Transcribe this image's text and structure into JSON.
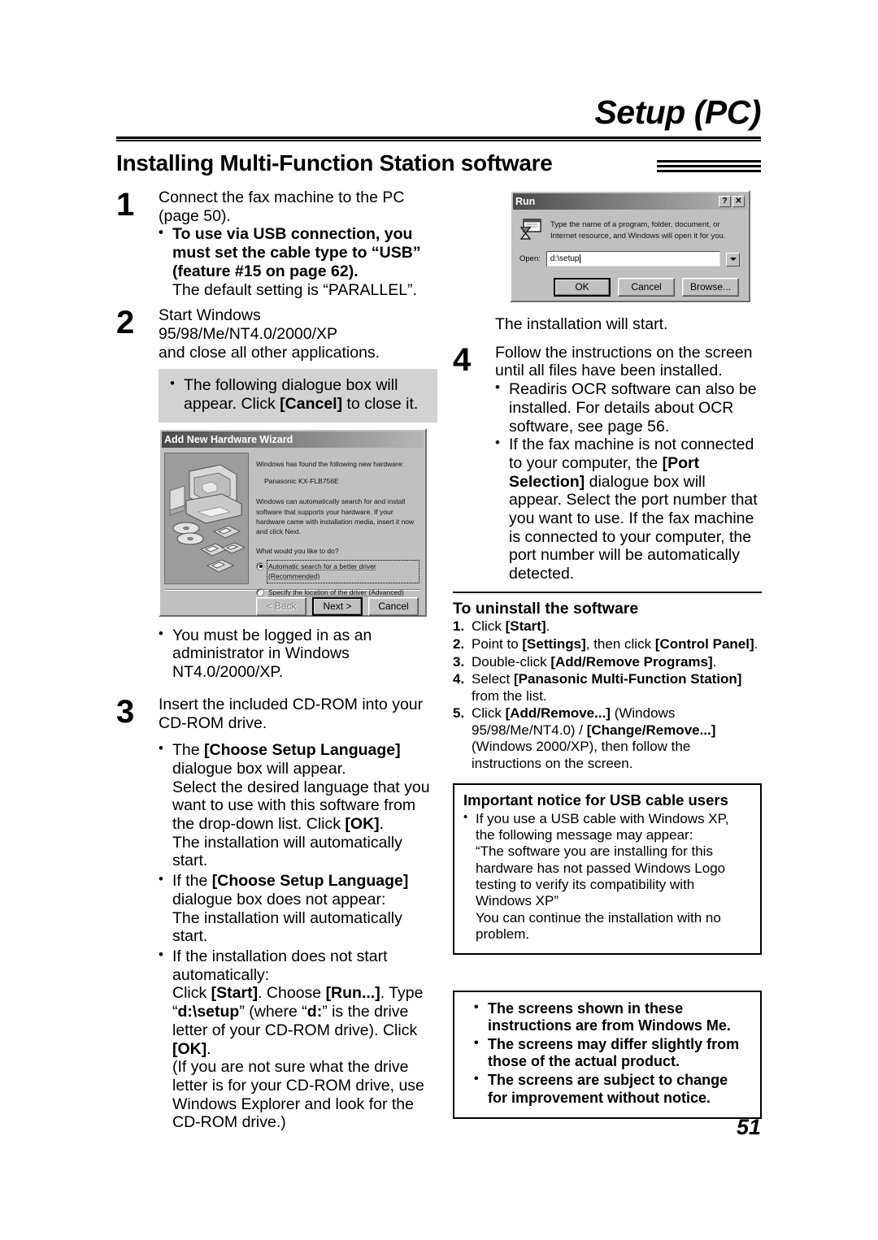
{
  "header": {
    "chapter": "Setup (PC)",
    "section": "Installing Multi-Function Station software"
  },
  "page_number": "51",
  "left_column": {
    "step1": {
      "number": "1",
      "line1": "Connect the fax machine to the PC",
      "line2": "(page 50).",
      "bullet_bold": "To use via USB connection, you must set the cable type to “USB” (feature #15 on page 62).",
      "bullet_note": "The default setting is “PARALLEL”."
    },
    "step2": {
      "number": "2",
      "line1": "Start Windows 95/98/Me/NT4.0/2000/XP",
      "line2": "and close all other applications."
    },
    "gray_callout": {
      "text_part1": "The following dialogue box will appear. Click ",
      "text_bold": "[Cancel]",
      "text_part2": " to close it."
    },
    "after_wizard_bullet": "You must be logged in as an administrator in Windows NT4.0/2000/XP.",
    "step3": {
      "number": "3",
      "line1": "Insert the included CD-ROM into your",
      "line2": "CD-ROM drive.",
      "bullet1_lead": "The ",
      "bullet1_bold": "[Choose Setup Language]",
      "bullet1_tail": " dialogue box will appear.",
      "bullet1_body_a": "Select the desired language that you want to use with this software from the drop-down list. Click ",
      "bullet1_body_ok": "[OK]",
      "bullet1_body_b": ".",
      "bullet1_body_c": "The installation will automatically start.",
      "bullet2_lead": "If the ",
      "bullet2_bold": "[Choose Setup Language]",
      "bullet2_tail": " dialogue box does not appear:",
      "bullet2_body": "The installation will automatically start.",
      "bullet3_lead": "If the installation does not start automatically:",
      "bullet3_l1_a": "Click ",
      "bullet3_l1_start": "[Start]",
      "bullet3_l1_b": ". Choose ",
      "bullet3_l1_run": "[Run...]",
      "bullet3_l1_c": ". Type",
      "bullet3_l2_a": "“",
      "bullet3_l2_path": "d:\\setup",
      "bullet3_l2_b": "” (where “",
      "bullet3_l2_drive": "d:",
      "bullet3_l2_c": "” is the drive letter of your CD-ROM drive). Click ",
      "bullet3_l2_ok": "[OK]",
      "bullet3_l2_d": ".",
      "bullet3_l3": "(If you are not sure what the drive letter is for your CD-ROM drive, use Windows Explorer and look for the CD-ROM drive.)"
    }
  },
  "wizard_dialog": {
    "title": "Add New Hardware Wizard",
    "found_text": "Windows has found the following new hardware:",
    "device_name": "Panasonic KX-FLB756E",
    "body_text": "Windows can automatically search for and install software that supports your hardware. If your hardware came with installation media, insert it now and click Next.",
    "question": "What would you like to do?",
    "option1": "Automatic search for a better driver (Recommended)",
    "option2": "Specify the location of the driver (Advanced)",
    "selected_option": "option1",
    "buttons": {
      "back": "< Back",
      "next": "Next >",
      "cancel": "Cancel"
    }
  },
  "run_dialog": {
    "title": "Run",
    "help_button": "?",
    "close_button": "✕",
    "description": "Type the name of a program, folder, document, or Internet resource, and Windows will open it for you.",
    "open_label": "Open:",
    "open_value": "d:\\setup",
    "buttons": {
      "ok": "OK",
      "cancel": "Cancel",
      "browse": "Browse..."
    }
  },
  "right_column": {
    "install_start": "The installation will start.",
    "step4": {
      "number": "4",
      "line1": "Follow the instructions on the screen",
      "line2": "until all files have been installed.",
      "bullet1": "Readiris OCR software can also be installed. For details about OCR software, see page 56.",
      "bullet2_a": "If the fax machine is not connected to your computer, the ",
      "bullet2_bold": "[Port Selection]",
      "bullet2_b": " dialogue box will appear. Select the port number that you want to use. If the fax machine is connected to your computer, the port number will be automatically detected."
    },
    "uninstall": {
      "heading": "To uninstall the software",
      "items": [
        {
          "n": "1.",
          "a": "Click ",
          "bold": "[Start]",
          "b": "."
        },
        {
          "n": "2.",
          "a": "Point to ",
          "bold": "[Settings]",
          "b": ", then click ",
          "bold2": "[Control Panel]",
          "c": "."
        },
        {
          "n": "3.",
          "a": "Double-click ",
          "bold": "[Add/Remove Programs]",
          "b": "."
        },
        {
          "n": "4.",
          "a": "Select ",
          "bold": "[Panasonic Multi-Function Station]",
          "b": " from the list."
        },
        {
          "n": "5.",
          "a": "Click ",
          "bold": "[Add/Remove...]",
          "b": " (Windows 95/98/Me/NT4.0) / ",
          "bold2": "[Change/Remove...]",
          "c": " (Windows 2000/XP), then follow the instructions on the screen."
        }
      ]
    },
    "usb_notice": {
      "heading": "Important notice for USB cable users",
      "bullet": "If you use a USB cable with Windows XP, the following message may appear:",
      "quote": "“The software you are installing for this hardware has not passed Windows Logo testing to verify its compatibility with Windows XP”",
      "tail": "You can continue the installation with no problem."
    },
    "screens_notice": {
      "bullet1": "The screens shown in these instructions are from Windows Me.",
      "bullet2": "The screens may differ slightly from those of the actual product.",
      "bullet3": "The screens are subject to change for improvement without notice."
    }
  }
}
